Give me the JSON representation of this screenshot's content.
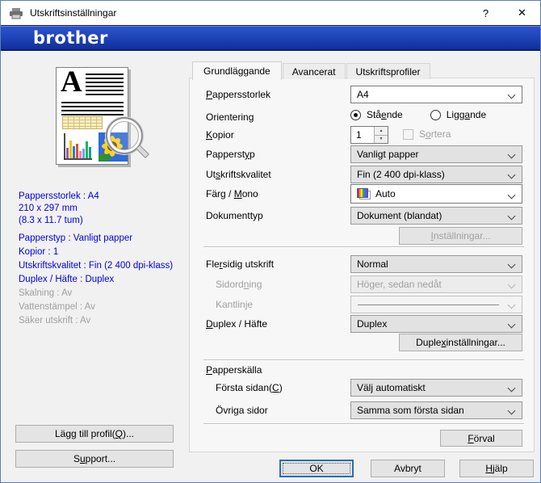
{
  "window": {
    "title": "Utskriftsinställningar",
    "help": "?",
    "close": "✕"
  },
  "brand": {
    "logo": "brother"
  },
  "colors": {
    "brand_blue": "#1d41b5",
    "summary_blue": "#0000e6",
    "disabled_text": "#9f9f9f",
    "default_button_border": "#2a6db5",
    "photo_blue": "#2f6bd9"
  },
  "preview": {
    "letter": "A"
  },
  "summary": {
    "size_lines": [
      "Pappersstorlek : A4",
      "210 x 297 mm",
      "(8.3 x 11.7 tum)"
    ],
    "items": [
      {
        "text": "Papperstyp : Vanligt papper"
      },
      {
        "text": "Kopior : 1"
      },
      {
        "text": "Utskriftskvalitet : Fin (2 400 dpi-klass)"
      },
      {
        "text": "Duplex / Häfte : Duplex"
      },
      {
        "text": "Skalning : Av"
      },
      {
        "text": "Vattenstämpel : Av"
      },
      {
        "text": "Säker utskrift : Av"
      }
    ]
  },
  "left_buttons": {
    "add_profile": "Lägg till profil([Q])...",
    "support": "S[u]pport..."
  },
  "tabs": [
    {
      "label": "Grundläggande"
    },
    {
      "label": "Avancerat"
    },
    {
      "label": "Utskriftsprofiler"
    }
  ],
  "form": {
    "pappersstorlek": {
      "label": "[P]appersstorlek",
      "value": "A4"
    },
    "orientering": {
      "label": "Orientering",
      "portrait": "Stå[e]nde",
      "landscape": "Ligg[a]nde"
    },
    "kopior": {
      "label": "[K]opior",
      "value": "1",
      "checkbox": "S[o]rtera"
    },
    "papperstyp": {
      "label": "Papperst[y]p",
      "value": "Vanligt papper"
    },
    "utskriftskvalitet": {
      "label": "Ut[s]kriftskvalitet",
      "value": "Fin (2 400 dpi-klass)"
    },
    "farg_mono": {
      "label": "Färg / [M]ono",
      "value": "Auto"
    },
    "dokumenttyp": {
      "label": "Dokumenttyp",
      "value": "Dokument (blandat)"
    },
    "installningar_btn": "[I]nställningar...",
    "flersidig": {
      "label": "Fle[r]sidig utskrift",
      "value": "Normal"
    },
    "sidordning": {
      "label": "Sidord[n]ing",
      "value": "Höger, sedan nedåt"
    },
    "kantlinje": {
      "label": "Kantlinje"
    },
    "duplex_hafte": {
      "label": "[D]uplex / Häfte",
      "value": "Duplex"
    },
    "duplexinstallningar_btn": "Duple[x]inställningar...",
    "papperskalla": {
      "label": "[P]apperskälla"
    },
    "forsta_sidan": {
      "label": "Första sidan([C])",
      "value": "Välj automatiskt"
    },
    "ovriga_sidor": {
      "label": "Övri[g]a sidor",
      "value": "Samma som första sidan"
    },
    "forval_btn": "[F]örval"
  },
  "footer": {
    "ok": "OK",
    "cancel": "Avbryt",
    "help": "[H]jälp"
  }
}
